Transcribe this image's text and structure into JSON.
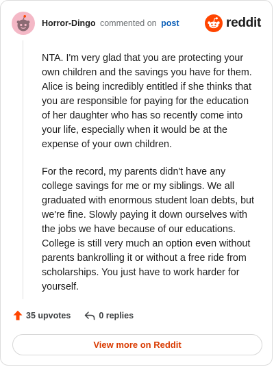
{
  "header": {
    "username": "Horror-Dingo",
    "action": "commented on",
    "link_label": "post",
    "brand": "reddit"
  },
  "comment": {
    "paragraphs": [
      "NTA. I'm very glad that you are protecting your own children and the savings you have for them. Alice is being incredibly entitled if she thinks that you are responsible for paying for the education of her daughter who has so recently come into your life, especially when it would be at the expense of your own children.",
      "For the record, my parents didn't have any college savings for me or my siblings. We all graduated with enormous student loan debts, but we're fine. Slowly paying it down ourselves with the jobs we have because of our educations. College is still very much an option even without parents bankrolling it or without a free ride from scholarships. You just have to work harder for yourself."
    ]
  },
  "stats": {
    "upvotes": "35 upvotes",
    "replies": "0 replies"
  },
  "footer": {
    "view_more": "View more on Reddit"
  },
  "colors": {
    "brand_orange": "#ff4500",
    "link_blue": "#0b5fb8",
    "view_more_text": "#d93a00",
    "avatar_bg": "#f4b8c6"
  },
  "icons": {
    "avatar": "snoo-avatar-icon",
    "brand": "reddit-logo-icon",
    "upvote": "upvote-arrow-icon",
    "reply": "reply-arrow-icon"
  }
}
